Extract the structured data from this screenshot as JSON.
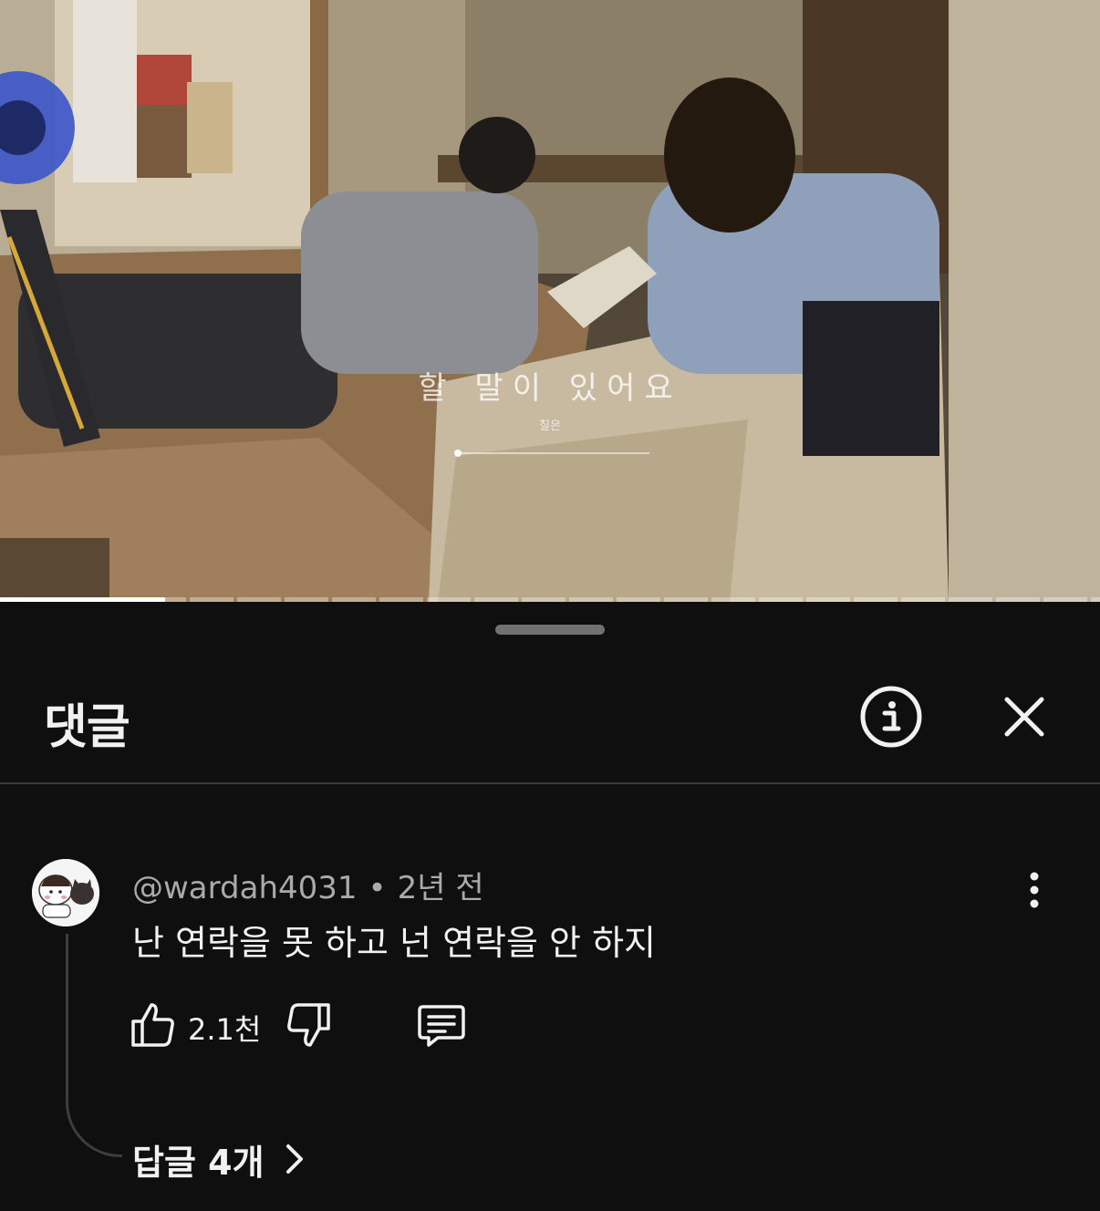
{
  "video": {
    "overlay_title": "할 말이 있어요",
    "overlay_artist": "칠은",
    "progress": 0.15
  },
  "comments_sheet": {
    "title": "댓글",
    "info_icon": "info-circle-icon",
    "close_icon": "close-icon"
  },
  "comment": {
    "author": "@wardah4031",
    "separator": "•",
    "time": "2년 전",
    "text": "난 연락을 못 하고 넌 연락을 안 하지",
    "like_count": "2.1천",
    "replies_label": "답글 4개"
  },
  "colors": {
    "background": "#0f0f0f",
    "text_primary": "#f1f1f1",
    "text_secondary": "#aaaaaa",
    "divider": "#3a3a3a"
  }
}
